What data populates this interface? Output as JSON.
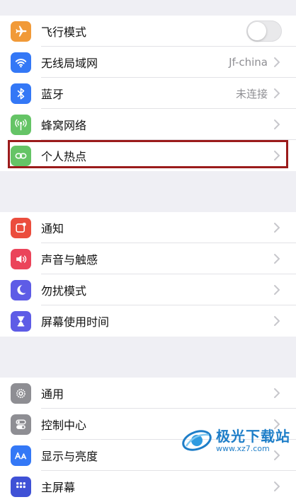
{
  "group1": {
    "items": [
      {
        "label": "飞行模式",
        "icon": "airplane-icon",
        "color": "#f19a38",
        "control": "toggle",
        "toggle_on": false
      },
      {
        "label": "无线局域网",
        "icon": "wifi-icon",
        "color": "#3478f6",
        "value": "Jf-china"
      },
      {
        "label": "蓝牙",
        "icon": "bluetooth-icon",
        "color": "#3478f6",
        "value": "未连接"
      },
      {
        "label": "蜂窝网络",
        "icon": "cellular-icon",
        "color": "#65c466"
      },
      {
        "label": "个人热点",
        "icon": "hotspot-icon",
        "color": "#65c466",
        "highlighted": true
      }
    ]
  },
  "group2": {
    "items": [
      {
        "label": "通知",
        "icon": "notification-icon",
        "color": "#eb4d3d"
      },
      {
        "label": "声音与触感",
        "icon": "sound-icon",
        "color": "#eb445a"
      },
      {
        "label": "勿扰模式",
        "icon": "moon-icon",
        "color": "#5e5ce6"
      },
      {
        "label": "屏幕使用时间",
        "icon": "hourglass-icon",
        "color": "#5e5ce6"
      }
    ]
  },
  "group3": {
    "items": [
      {
        "label": "通用",
        "icon": "gear-icon",
        "color": "#8e8e93"
      },
      {
        "label": "控制中心",
        "icon": "switches-icon",
        "color": "#8e8e93"
      },
      {
        "label": "显示与亮度",
        "icon": "text-size-icon",
        "color": "#3478f6"
      },
      {
        "label": "主屏幕",
        "icon": "home-grid-icon",
        "color": "#3f51d6"
      }
    ]
  },
  "watermark": {
    "title": "极光下载站",
    "url": "www.xz7.com",
    "color": "#1e7ec8"
  },
  "highlight_color": "#9b1b1b"
}
